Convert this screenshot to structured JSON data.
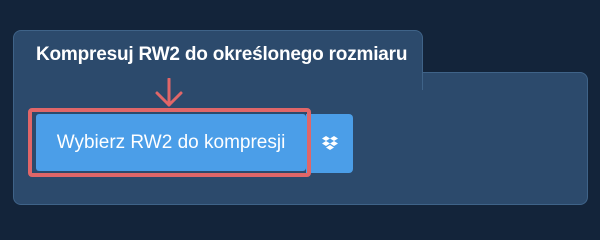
{
  "panel": {
    "tab_title": "Kompresuj RW2 do określonego rozmiaru"
  },
  "actions": {
    "main_button_label": "Wybierz RW2 do kompresji",
    "dropbox_icon": "dropbox-icon"
  },
  "colors": {
    "page_background": "#13243a",
    "panel_background": "#2c4a6c",
    "button_background": "#4b9ee8",
    "highlight": "#e06668"
  }
}
